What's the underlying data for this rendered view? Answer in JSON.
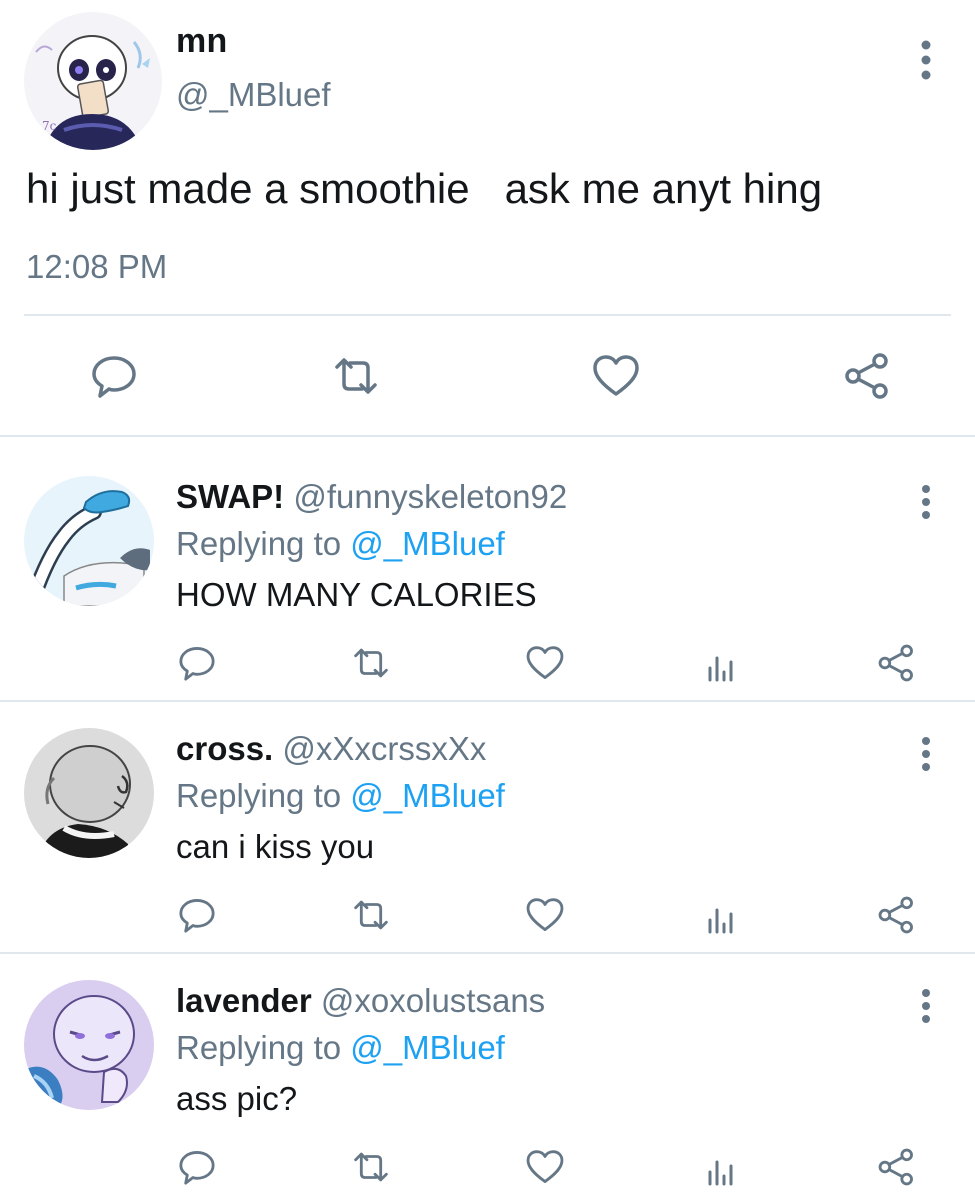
{
  "main_tweet": {
    "author_name": "mn",
    "author_handle": "@_MBluef",
    "text": "hi just made a smoothie   ask me anyt hing",
    "time": "12:08 PM",
    "avatar_icon": "skeleton-avatar-icon",
    "actions": [
      "reply-icon",
      "retweet-icon",
      "like-icon",
      "share-icon"
    ]
  },
  "replies": [
    {
      "name": "SWAP!",
      "handle": "@funnyskeleton92",
      "replying_prefix": "Replying to",
      "replying_handle": "@_MBluef",
      "text": "HOW MANY CALORIES",
      "avatar_icon": "flexing-arm-avatar-icon"
    },
    {
      "name": "cross.",
      "handle": "@xXxcrssxXx",
      "replying_prefix": "Replying to",
      "replying_handle": "@_MBluef",
      "text": "can i kiss you",
      "avatar_icon": "grayscale-skeleton-avatar-icon"
    },
    {
      "name": "lavender",
      "handle": "@xoxolustsans",
      "replying_prefix": "Replying to",
      "replying_handle": "@_MBluef",
      "text": "ass pic?",
      "avatar_icon": "purple-skeleton-avatar-icon"
    }
  ],
  "colors": {
    "text": "#14171a",
    "secondary": "#657786",
    "link": "#1da1f2",
    "divider": "#e1e8ed",
    "icon": "#657786"
  }
}
